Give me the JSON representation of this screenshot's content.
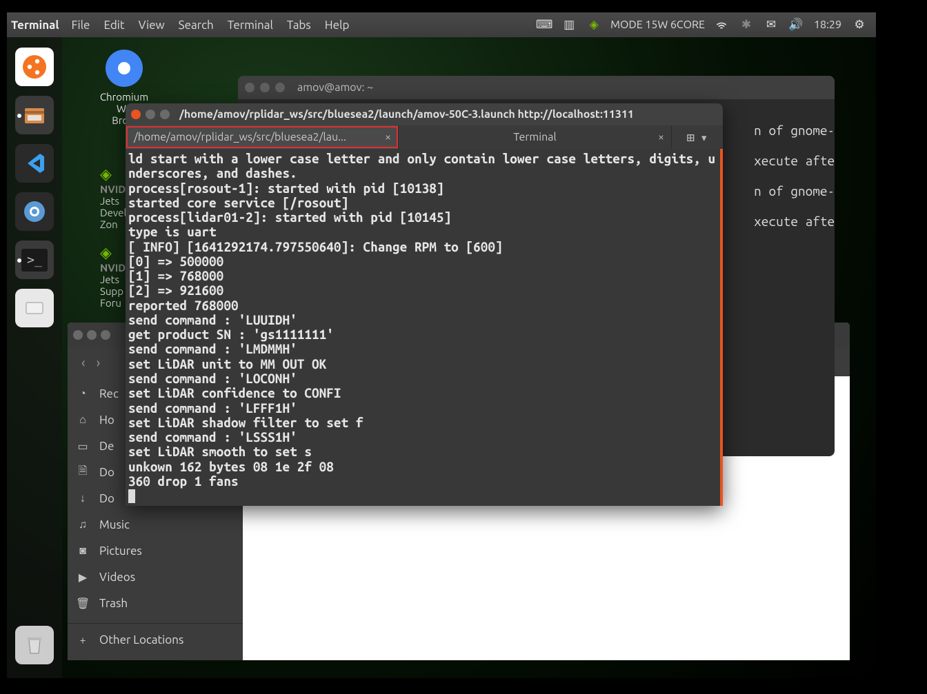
{
  "menubar": {
    "app": "Terminal",
    "items": [
      "File",
      "Edit",
      "View",
      "Search",
      "Terminal",
      "Tabs",
      "Help"
    ],
    "mode": "MODE 15W 6CORE",
    "clock": "18:29"
  },
  "launcher": {
    "icons": [
      "ubuntu",
      "files",
      "vscode",
      "chrome",
      "terminal",
      "disk",
      "trash"
    ]
  },
  "desktop_icon": {
    "label_line1": "Chromium",
    "label_line2": "We",
    "label_line3": "Brow"
  },
  "nvidia_labels": {
    "jets1": "Jets",
    "devel": "Devel",
    "zon": "Zon",
    "jets2": "Jets",
    "supp": "Supp",
    "foru": "Foru"
  },
  "files_window": {
    "sidebar": [
      {
        "icon": "◔",
        "label": "Rec"
      },
      {
        "icon": "⌂",
        "label": "Ho"
      },
      {
        "icon": "▭",
        "label": "De"
      },
      {
        "icon": "🗎",
        "label": "Do"
      },
      {
        "icon": "↓",
        "label": "Do"
      },
      {
        "icon": "♫",
        "label": "Music"
      },
      {
        "icon": "◙",
        "label": "Pictures"
      },
      {
        "icon": "▶",
        "label": "Videos"
      },
      {
        "icon": "🗑",
        "label": "Trash"
      },
      {
        "icon": "+",
        "label": "Other Locations"
      }
    ]
  },
  "term_back": {
    "title": "amov@amov: ~",
    "lines": [
      "",
      "                                                                     n of gnome-ter",
      "",
      "                                                                     xecute after i",
      "",
      "                                                                     n of gnome-ter",
      "",
      "                                                                     xecute after i"
    ]
  },
  "term_front": {
    "title": "/home/amov/rplidar_ws/src/bluesea2/launch/amov-50C-3.launch http://localhost:11311",
    "tabs": [
      {
        "label": "/home/amov/rplidar_ws/src/bluesea2/lau...",
        "active": true,
        "highlighted": true
      },
      {
        "label": "Terminal",
        "active": false,
        "highlighted": false
      }
    ],
    "output": [
      "ld start with a lower case letter and only contain lower case letters, digits, u",
      "nderscores, and dashes.",
      "process[rosout-1]: started with pid [10138]",
      "started core service [/rosout]",
      "process[lidar01-2]: started with pid [10145]",
      "type is uart",
      "[ INFO] [1641292174.797550640]: Change RPM to [600]",
      "[0] => 500000",
      "[1] => 768000",
      "[2] => 921600",
      "reported 768000",
      "send command : 'LUUIDH'",
      "get product SN : 'gs1111111'",
      "send command : 'LMDMMH'",
      "set LiDAR unit to MM OUT OK",
      "send command : 'LOCONH'",
      "set LiDAR confidence to CONFI",
      "send command : 'LFFF1H'",
      "set LiDAR shadow filter to set f",
      "send command : 'LSSS1H'",
      "set LiDAR smooth to set s",
      "unkown 162 bytes 08 1e 2f 08",
      "360 drop 1 fans"
    ]
  }
}
